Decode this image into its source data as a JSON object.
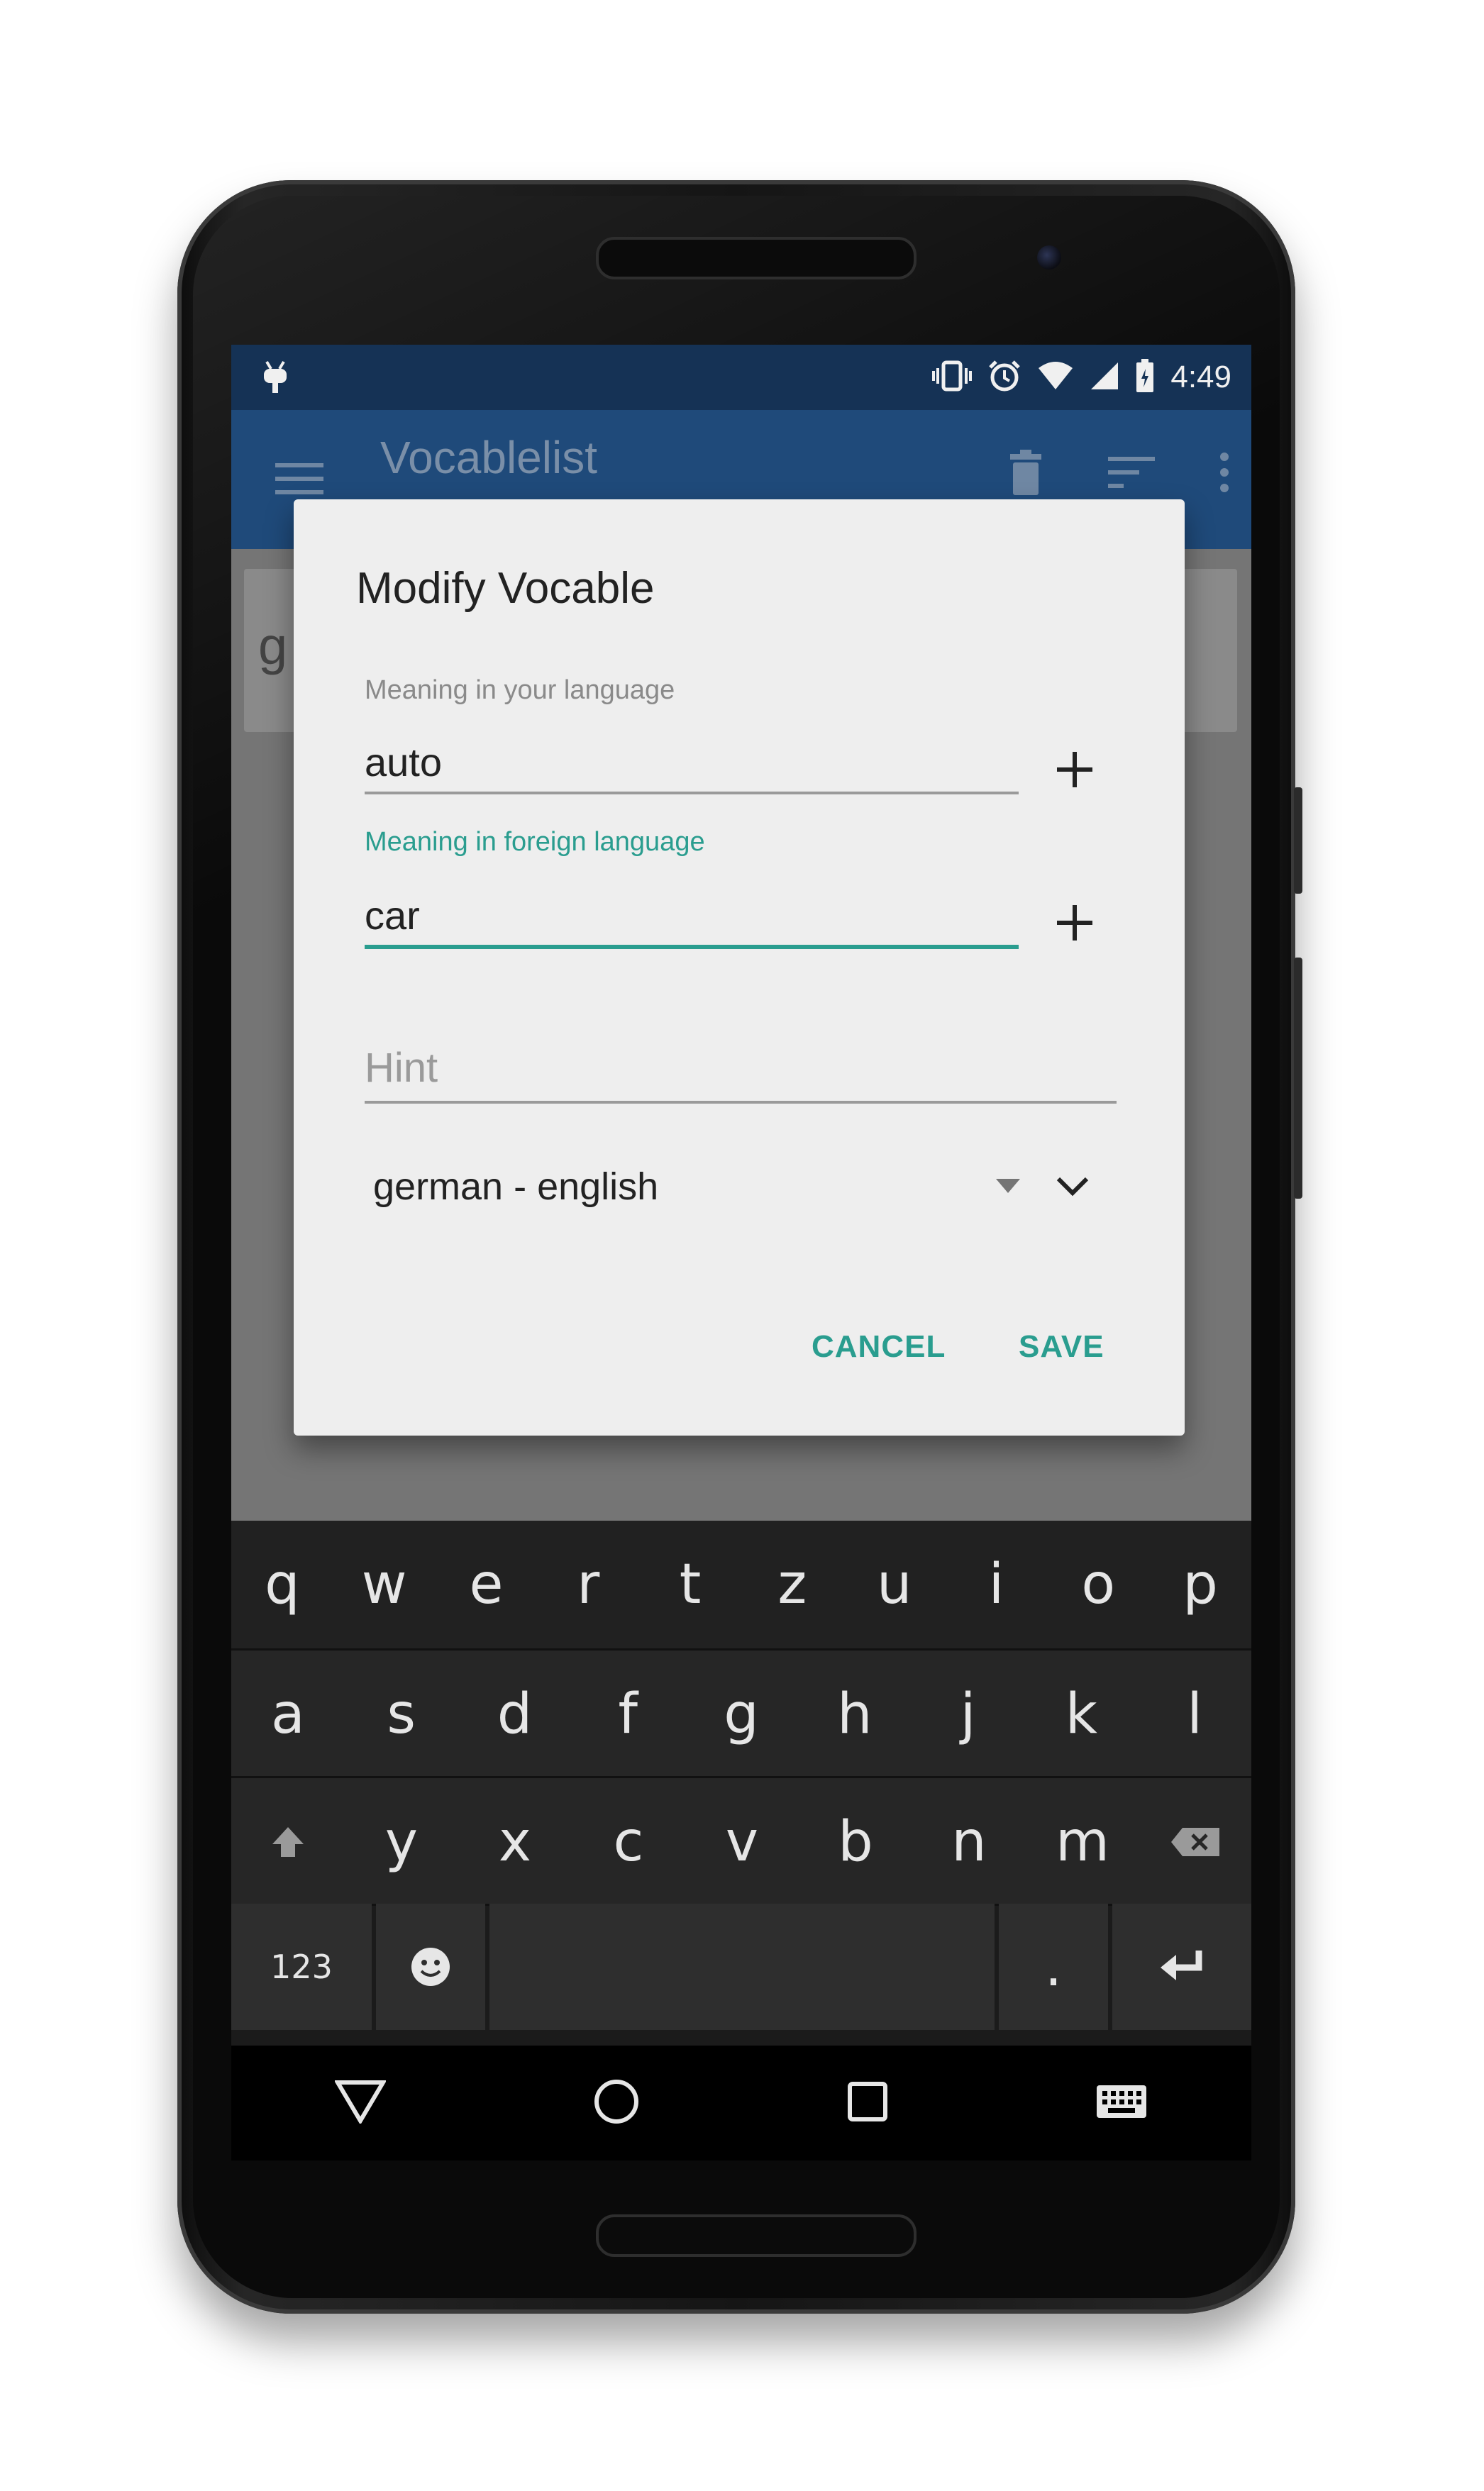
{
  "status_bar": {
    "time": "4:49",
    "icons": [
      "android-debug-icon",
      "vibrate-icon",
      "alarm-icon",
      "wifi-icon",
      "signal-icon",
      "battery-icon"
    ]
  },
  "app_bar": {
    "title": "Vocablelist",
    "actions": [
      "menu-icon",
      "delete-icon",
      "sort-icon",
      "more-vert-icon"
    ]
  },
  "list": {
    "first_item_text": "g"
  },
  "dialog": {
    "title": "Modify Vocable",
    "native_label": "Meaning in your language",
    "native_value": "auto",
    "foreign_label": "Meaning in foreign language",
    "foreign_value": "car",
    "hint_placeholder": "Hint",
    "language_pair": "german - english",
    "cancel_label": "CANCEL",
    "save_label": "SAVE"
  },
  "keyboard": {
    "row1": [
      "q",
      "w",
      "e",
      "r",
      "t",
      "z",
      "u",
      "i",
      "o",
      "p"
    ],
    "row2": [
      "a",
      "s",
      "d",
      "f",
      "g",
      "h",
      "j",
      "k",
      "l"
    ],
    "row3": [
      "y",
      "x",
      "c",
      "v",
      "b",
      "n",
      "m"
    ],
    "symbols_label": "123",
    "period_label": "."
  },
  "colors": {
    "accent": "#2a9d8f",
    "status_bar": "#153255",
    "app_bar": "#1f4a7a",
    "dialog_bg": "#eeeeee",
    "keyboard_bg": "#1b1b1b"
  }
}
